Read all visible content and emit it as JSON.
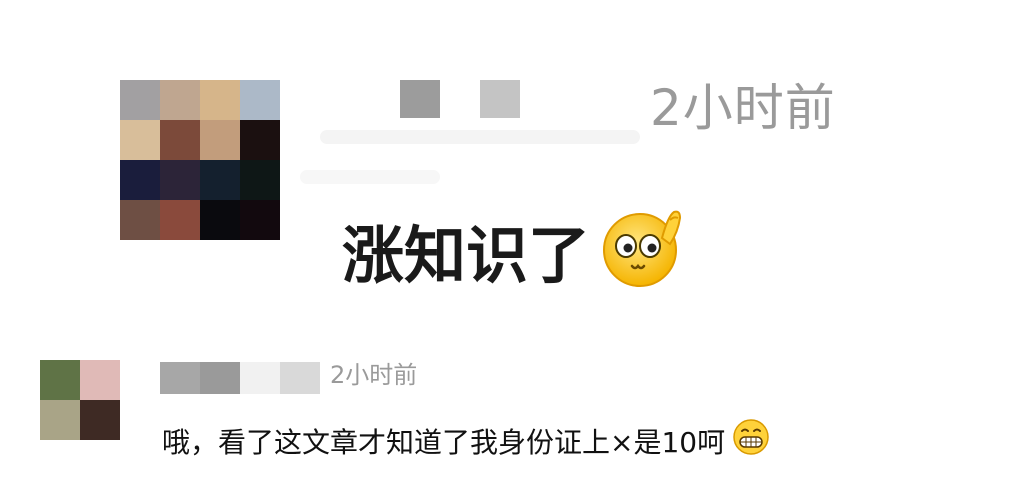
{
  "comments": [
    {
      "avatar_colors": [
        "#a2a0a2",
        "#bfa690",
        "#d6b58a",
        "#acb9c8",
        "#d8be9a",
        "#7c4a3a",
        "#c29d7c",
        "#1b1010",
        "#1a1d3c",
        "#2c2438",
        "#14202e",
        "#0e1716",
        "#6e4f44",
        "#8a4a3c",
        "#0a0a0e",
        "#12090e"
      ],
      "name_blur_colors": [
        "#9c9c9c",
        "#c4c4c4"
      ],
      "timestamp": "2小时前",
      "text": "涨知识了",
      "emoji_icon": "face-thinking-cute-emoji"
    },
    {
      "avatar_colors": [
        "#5f7346",
        "#e0bab7",
        "#a9a487",
        "#3e2a24"
      ],
      "name_blur_colors": [
        "#a7a7a7",
        "#9a9a9a",
        "#f1f1f1",
        "#d9d9d9"
      ],
      "timestamp": "2小时前",
      "text": "哦，看了这文章才知道了我身份证上×是10呵",
      "emoji_icon": "grinning-face-emoji"
    }
  ]
}
